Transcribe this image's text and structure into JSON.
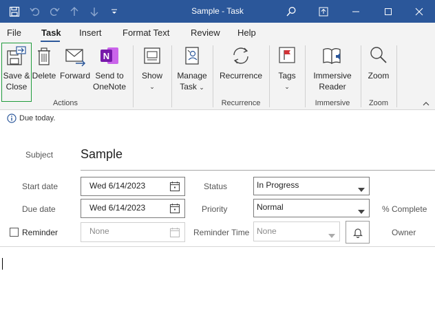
{
  "window": {
    "title": "Sample  -  Task"
  },
  "tabs": [
    {
      "label": "File"
    },
    {
      "label": "Task"
    },
    {
      "label": "Insert"
    },
    {
      "label": "Format Text"
    },
    {
      "label": "Review"
    },
    {
      "label": "Help"
    }
  ],
  "ribbon": {
    "actions": {
      "save_close_line1": "Save &",
      "save_close_line2": "Close",
      "delete": "Delete",
      "forward": "Forward",
      "send_onenote_line1": "Send to",
      "send_onenote_line2": "OneNote",
      "group_label": "Actions"
    },
    "show": {
      "label": "Show"
    },
    "manage_task": {
      "line1": "Manage",
      "line2": "Task"
    },
    "recurrence": {
      "label": "Recurrence",
      "group_label": "Recurrence"
    },
    "tags": {
      "label": "Tags"
    },
    "immersive": {
      "line1": "Immersive",
      "line2": "Reader",
      "group_label": "Immersive"
    },
    "zoom": {
      "label": "Zoom",
      "group_label": "Zoom"
    },
    "accent_color": "#2b579a",
    "onenote_color": "#7719aa",
    "highlight_color": "#1e9b3a",
    "flag_color": "#d13438"
  },
  "infobar": {
    "message": "Due today."
  },
  "form": {
    "subject_label": "Subject",
    "subject_value": "Sample",
    "start_date_label": "Start date",
    "start_date_value": "Wed 6/14/2023",
    "due_date_label": "Due date",
    "due_date_value": "Wed 6/14/2023",
    "reminder_label": "Reminder",
    "reminder_value": "None",
    "status_label": "Status",
    "status_value": "In Progress",
    "priority_label": "Priority",
    "priority_value": "Normal",
    "reminder_time_label": "Reminder Time",
    "reminder_time_value": "None",
    "percent_complete_label": "% Complete",
    "owner_label": "Owner",
    "reminder_checked": false
  }
}
